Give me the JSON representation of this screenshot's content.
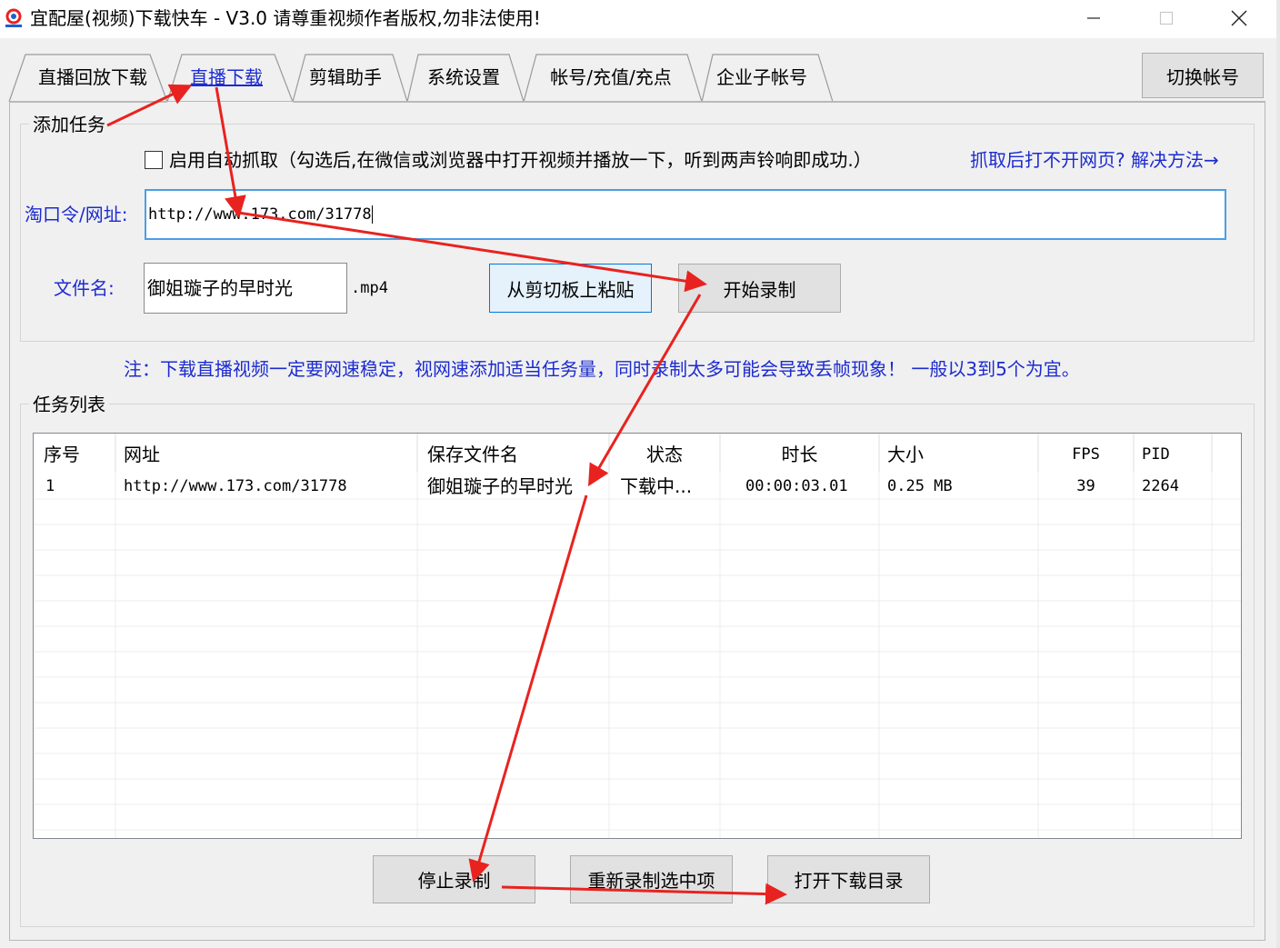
{
  "window": {
    "title": "宜配屋(视频)下载快车 - V3.0 请尊重视频作者版权,勿非法使用!",
    "minimize_icon": "minimize-icon",
    "maximize_icon": "maximize-icon",
    "close_icon": "close-icon"
  },
  "tabs": [
    {
      "label": "直播回放下载"
    },
    {
      "label": "直播下载"
    },
    {
      "label": "剪辑助手"
    },
    {
      "label": "系统设置"
    },
    {
      "label": "帐号/充值/充点"
    },
    {
      "label": "企业子帐号"
    }
  ],
  "switch_account": "切换帐号",
  "add_task": {
    "group_title": "添加任务",
    "auto_capture_label": "启用自动抓取（勾选后,在微信或浏览器中打开视频并播放一下，听到两声铃响即成功.）",
    "help_link": "抓取后打不开网页? 解决方法→",
    "url_label": "淘口令/网址:",
    "url_value": "http://www.173.com/31778",
    "filename_label": "文件名:",
    "filename_value": "御姐璇子的早时光",
    "ext": ".mp4",
    "paste_button": "从剪切板上粘贴",
    "start_button": "开始录制"
  },
  "note": "注：下载直播视频一定要网速稳定，视网速添加适当任务量，同时录制太多可能会导致丢帧现象！ 一般以3到5个为宜。",
  "task_list": {
    "group_title": "任务列表",
    "columns": [
      "序号",
      "网址",
      "保存文件名",
      "状态",
      "时长",
      "大小",
      "FPS",
      "PID"
    ],
    "rows": [
      {
        "index": "1",
        "url": "http://www.173.com/31778",
        "filename": "御姐璇子的早时光",
        "status": "下载中...",
        "duration": "00:00:03.01",
        "size": "0.25 MB",
        "fps": "39",
        "pid": "2264"
      }
    ]
  },
  "buttons": {
    "stop": "停止录制",
    "rerecord": "重新录制选中项",
    "open_dir": "打开下载目录"
  },
  "colors": {
    "accent_blue": "#1c2bd0",
    "annotation_red": "#e8231f"
  }
}
